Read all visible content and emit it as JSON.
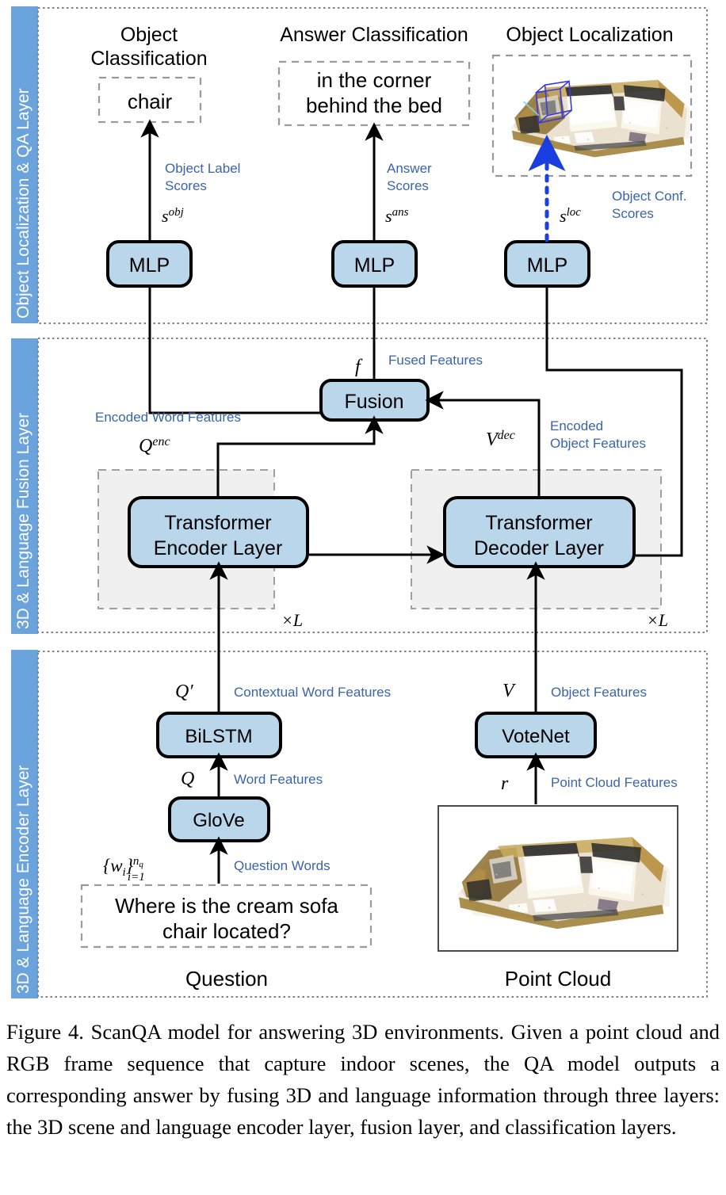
{
  "figure": {
    "caption": "Figure 4. ScanQA model for answering 3D environments. Given a point cloud and RGB frame sequence that capture indoor scenes, the QA model outputs a corresponding answer by fusing 3D and language information through three layers: the 3D scene and language encoder layer, fusion layer, and classification layers."
  },
  "colors": {
    "band_blue": "#6BA3DC",
    "node_fill": "#BAD6EA",
    "node_stroke": "#000000",
    "label_blue": "#3A64AB",
    "group_fill": "#F0F0F0",
    "group_stroke": "#A0A0A0",
    "dotted_border": "#808080",
    "loc_arrow": "#1A3FE0",
    "bbox_blue": "#3A3ADC"
  },
  "layers": [
    {
      "id": "top",
      "band_label": "Object Localization & QA Layer"
    },
    {
      "id": "middle",
      "band_label": "3D & Language Fusion Layer"
    },
    {
      "id": "bottom",
      "band_label": "3D & Language Encoder Layer"
    }
  ],
  "top_layer": {
    "columns": [
      {
        "title_line1": "Object",
        "title_line2": "Classification",
        "output_text": "chair",
        "edge_label_line1": "Object Label",
        "edge_label_line2": "Scores",
        "symbol": "s",
        "symbol_sup": "obj",
        "node": "MLP"
      },
      {
        "title_line1": "Answer Classification",
        "title_line2": "",
        "output_line1": "in the corner",
        "output_line2": "behind the bed",
        "edge_label_line1": "Answer",
        "edge_label_line2": "Scores",
        "symbol": "s",
        "symbol_sup": "ans",
        "node": "MLP"
      },
      {
        "title_line1": "Object Localization",
        "title_line2": "",
        "output_text": "point-cloud-with-bbox",
        "edge_label_line1": "Object Conf.",
        "edge_label_line2": "Scores",
        "symbol": "s",
        "symbol_sup": "loc",
        "node": "MLP"
      }
    ]
  },
  "fusion_layer": {
    "fusion_node": "Fusion",
    "fused_symbol": "f",
    "fused_label": "Fused Features",
    "encoder_node_line1": "Transformer",
    "encoder_node_line2": "Encoder Layer",
    "decoder_node_line1": "Transformer",
    "decoder_node_line2": "Decoder Layer",
    "encoded_word_label": "Encoded Word Features",
    "encoded_word_symbol": "Q",
    "encoded_word_symbol_sup": "enc",
    "encoded_object_label_line1": "Encoded",
    "encoded_object_label_line2": "Object Features",
    "encoded_object_symbol": "V",
    "encoded_object_symbol_sup": "dec",
    "repeat_left": "×L",
    "repeat_right": "×L"
  },
  "encoder_layer": {
    "bilstm_node": "BiLSTM",
    "glove_node": "GloVe",
    "votenet_node": "VoteNet",
    "contextual_symbol": "Q′",
    "contextual_label": "Contextual Word Features",
    "word_symbol": "Q",
    "word_label": "Word Features",
    "question_words_symbol": "{wi}ⁿq i=1",
    "question_words_label": "Question Words",
    "question_text_line1": "Where is the cream sofa",
    "question_text_line2": "chair located?",
    "question_caption": "Question",
    "object_symbol": "V",
    "object_label": "Object Features",
    "pointcloud_symbol": "r",
    "pointcloud_label": "Point Cloud Features",
    "pointcloud_caption": "Point Cloud"
  }
}
